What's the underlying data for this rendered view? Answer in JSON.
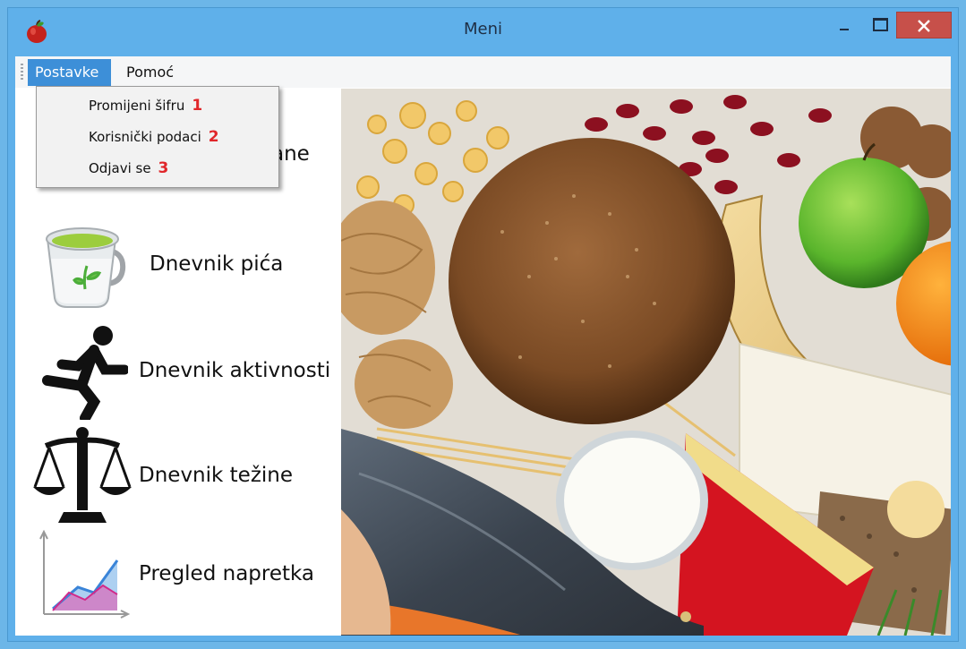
{
  "window": {
    "title": "Meni"
  },
  "menubar": {
    "items": [
      {
        "label": "Postavke"
      },
      {
        "label": "Pomoć"
      }
    ]
  },
  "dropdown": {
    "items": [
      {
        "label": "Promijeni šifru",
        "marker": "1"
      },
      {
        "label": "Korisnički podaci",
        "marker": "2"
      },
      {
        "label": "Odjavi se",
        "marker": "3"
      }
    ]
  },
  "nav": {
    "items": [
      {
        "label": "ane",
        "icon": "food-icon"
      },
      {
        "label": "Dnevnik pića",
        "icon": "tea-cup-icon"
      },
      {
        "label": "Dnevnik aktivnosti",
        "icon": "running-man-icon"
      },
      {
        "label": "Dnevnik težine",
        "icon": "scales-icon"
      },
      {
        "label": "Pregled napretka",
        "icon": "chart-icon"
      }
    ]
  },
  "colors": {
    "titlebar": "#5fb0ea",
    "menu_highlight": "#3d8fd8",
    "close_button": "#c7504a",
    "marker_red": "#e0262a"
  }
}
